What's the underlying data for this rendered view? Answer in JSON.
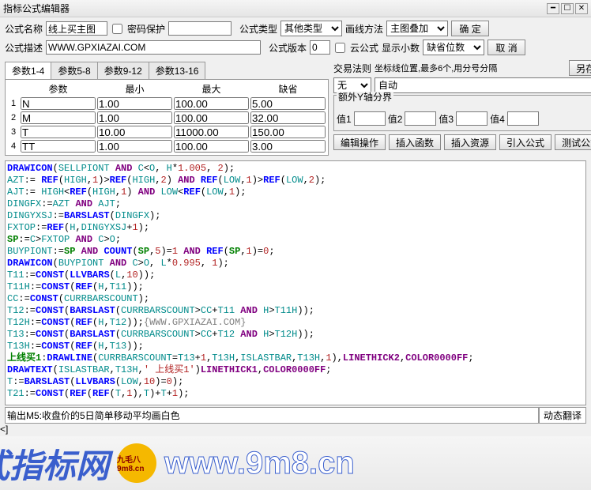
{
  "window": {
    "title": "指标公式编辑器"
  },
  "top": {
    "name_label": "公式名称",
    "name_value": "线上买主图",
    "pwd_label": "密码保护",
    "type_label": "公式类型",
    "type_value": "其他类型",
    "draw_label": "画线方法",
    "draw_value": "主图叠加",
    "ok": "确 定",
    "desc_label": "公式描述",
    "desc_value": "WWW.GPXIAZAI.COM",
    "ver_label": "公式版本",
    "ver_value": "0",
    "cloud_label": "云公式",
    "dec_label": "显示小数",
    "dec_value": "缺省位数",
    "cancel": "取 消"
  },
  "tabs": [
    "参数1-4",
    "参数5-8",
    "参数9-12",
    "参数13-16"
  ],
  "param_headers": [
    "参数",
    "最小",
    "最大",
    "缺省"
  ],
  "params": [
    {
      "n": "1",
      "name": "N",
      "min": "1.00",
      "max": "100.00",
      "def": "5.00"
    },
    {
      "n": "2",
      "name": "M",
      "min": "1.00",
      "max": "100.00",
      "def": "32.00"
    },
    {
      "n": "3",
      "name": "T",
      "min": "10.00",
      "max": "11000.00",
      "def": "150.00"
    },
    {
      "n": "4",
      "name": "TT",
      "min": "1.00",
      "max": "100.00",
      "def": "3.00"
    }
  ],
  "rules": {
    "label": "交易法则",
    "hint": "坐标线位置,最多6个,用分号分隔",
    "sel1": "无",
    "sel2": "自动",
    "extra_label": "额外Y轴分界",
    "v1": "值1",
    "v2": "值2",
    "v3": "值3",
    "v4": "值4",
    "save_as": "另存为"
  },
  "buttons": {
    "edit": "编辑操作",
    "insfn": "插入函数",
    "insres": "插入资源",
    "import": "引入公式",
    "test": "测试公式"
  },
  "status": {
    "msg": "输出M5:收盘价的5日简单移动平均画白色",
    "right": "动态翻译"
  },
  "banner": {
    "text1": "式指标网",
    "url": "www.9m8.cn",
    "logo": "九毛八\n9m8.cn"
  }
}
